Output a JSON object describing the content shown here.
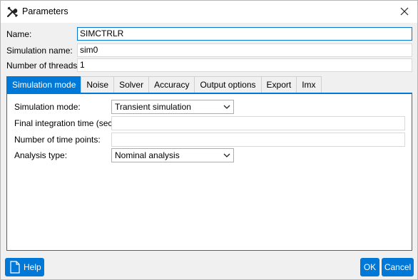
{
  "window": {
    "title": "Parameters",
    "icon": "tools-icon",
    "close_icon": "close-icon"
  },
  "fields": {
    "name_label": "Name:",
    "name_value": "SIMCTRLR",
    "sim_name_label": "Simulation name:",
    "sim_name_value": "sim0",
    "threads_label": "Number of threads:",
    "threads_value": "1"
  },
  "tabs": [
    {
      "label": "Simulation mode",
      "active": true
    },
    {
      "label": "Noise"
    },
    {
      "label": "Solver"
    },
    {
      "label": "Accuracy"
    },
    {
      "label": "Output options"
    },
    {
      "label": "Export"
    },
    {
      "label": "Imx"
    }
  ],
  "panel": {
    "sim_mode_label": "Simulation mode:",
    "sim_mode_value": "Transient simulation",
    "final_time_label": "Final integration time (sec):",
    "final_time_value": "",
    "time_points_label": "Number of time points:",
    "time_points_value": "",
    "analysis_label": "Analysis type:",
    "analysis_value": "Nominal analysis"
  },
  "footer": {
    "help_label": "Help",
    "help_icon": "document-icon",
    "ok_label": "OK",
    "cancel_label": "Cancel"
  },
  "colors": {
    "accent": "#0078d7",
    "background": "#f0f0f0"
  }
}
